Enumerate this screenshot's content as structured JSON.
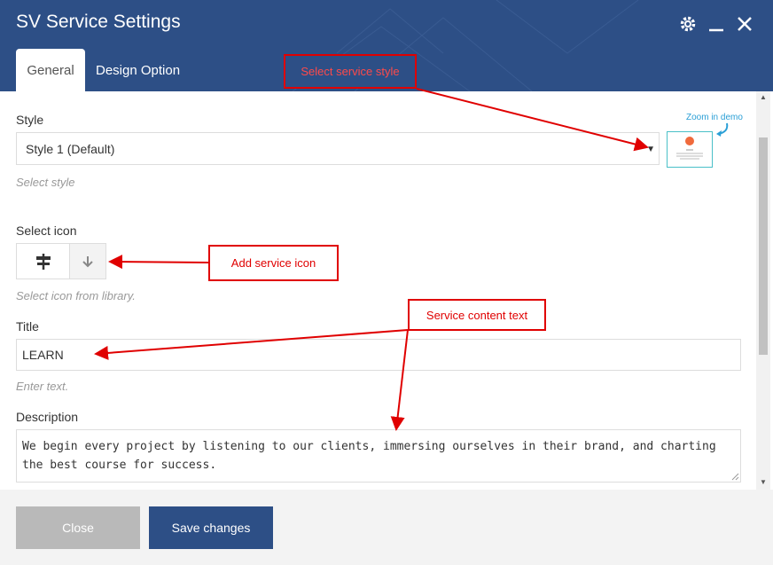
{
  "window": {
    "title": "SV Service Settings",
    "icons": [
      "gear-icon",
      "minimize-icon",
      "close-icon"
    ]
  },
  "tabs": [
    {
      "label": "General",
      "active": true
    },
    {
      "label": "Design Option",
      "active": false
    }
  ],
  "fields": {
    "style": {
      "label": "Style",
      "value": "Style 1 (Default)",
      "hint": "Select style",
      "preview_note": "Zoom in demo"
    },
    "icon": {
      "label": "Select icon",
      "selected_icon": "signpost-icon",
      "hint": "Select icon from library."
    },
    "title": {
      "label": "Title",
      "value": "LEARN",
      "hint": "Enter text."
    },
    "description": {
      "label": "Description",
      "value": "We begin every project by listening to our clients, immersing ourselves in their brand, and charting the best course for success."
    }
  },
  "footer": {
    "close_label": "Close",
    "save_label": "Save changes"
  },
  "annotations": {
    "style": "Select service style",
    "icon": "Add service icon",
    "text": "Service content text"
  },
  "colors": {
    "header": "#2d4f86",
    "annotation": "#e00000",
    "accent": "#2a9fd6"
  }
}
